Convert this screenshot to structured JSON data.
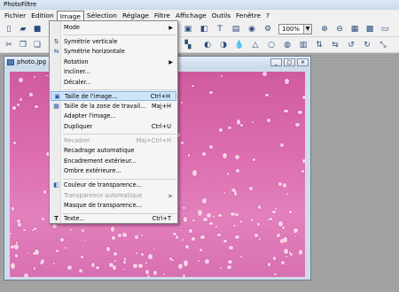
{
  "app": {
    "title": "PhotoFiltre"
  },
  "menubar": [
    "Fichier",
    "Edition",
    "Image",
    "Sélection",
    "Réglage",
    "Filtre",
    "Affichage",
    "Outils",
    "Fenêtre",
    "?"
  ],
  "toolbar": {
    "zoom_value": "100%"
  },
  "document": {
    "title": "photo.jpg"
  },
  "image_menu": {
    "items": [
      {
        "label": "Mode",
        "submenu": true
      },
      {
        "label": "Symétrie verticale",
        "icon": "flip-vertical-icon"
      },
      {
        "label": "Symétrie horizontale",
        "icon": "flip-horizontal-icon"
      },
      {
        "label": "Rotation",
        "submenu": true
      },
      {
        "label": "Incliner..."
      },
      {
        "label": "Décaler..."
      },
      {
        "label": "Taille de l'image...",
        "shortcut": "Ctrl+H",
        "icon": "image-size-icon",
        "highlighted": true
      },
      {
        "label": "Taille de la zone de travail...",
        "shortcut": "Maj+H",
        "icon": "canvas-size-icon"
      },
      {
        "label": "Adapter l'image..."
      },
      {
        "label": "Dupliquer",
        "shortcut": "Ctrl+U"
      },
      {
        "label": "Recadrer",
        "shortcut": "Maj+Ctrl+H",
        "disabled": true
      },
      {
        "label": "Recadrage automatique"
      },
      {
        "label": "Encadrement extérieur..."
      },
      {
        "label": "Ombre extérieure..."
      },
      {
        "label": "Couleur de transparence...",
        "icon": "transparency-color-icon"
      },
      {
        "label": "Transparence automatique",
        "submenu": true,
        "disabled": true
      },
      {
        "label": "Masque de transparence..."
      },
      {
        "label": "Texte...",
        "shortcut": "Ctrl+T",
        "icon": "text-icon"
      }
    ]
  }
}
